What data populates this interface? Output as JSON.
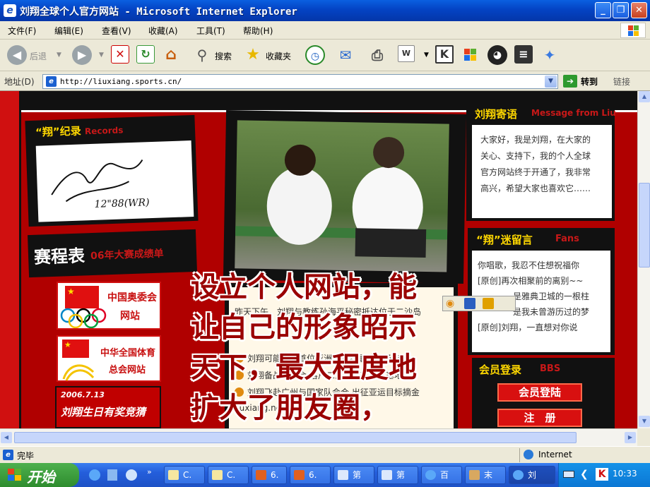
{
  "window": {
    "title": "刘翔全球个人官方网站 - Microsoft Internet Explorer",
    "app_icon": "ie-icon",
    "controls": [
      "minimize-icon",
      "maximize-icon",
      "close-icon"
    ]
  },
  "menubar": {
    "items": [
      "文件(F)",
      "编辑(E)",
      "查看(V)",
      "收藏(A)",
      "工具(T)",
      "帮助(H)"
    ]
  },
  "toolbar": {
    "back": "后退",
    "search": "搜索",
    "favorites": "收藏夹"
  },
  "addressbar": {
    "label": "地址(D)",
    "url": "http://liuxiang.sports.cn/",
    "go": "转到",
    "links": "链接"
  },
  "site": {
    "records": {
      "title": "“翔”纪录",
      "subtitle": "Records",
      "signature": "12\"88(WR)"
    },
    "schedule": {
      "title": "赛程表",
      "subtitle": "06年大赛成绩单"
    },
    "links": [
      {
        "line1": "中国奥委会",
        "line2": "网站"
      },
      {
        "line1": "中华全国体育",
        "line2": "总会网站"
      }
    ],
    "birthday_banner": {
      "date": "2006.7.13",
      "text": "刘翔生日有奖竞猜"
    },
    "message": {
      "title": "刘翔寄语",
      "subtitle": "Message from Liu",
      "lines": [
        "大家好，我是刘翔，在大家的",
        "关心、支持下，我的个人全球",
        "官方网站终于开通了，我非常",
        "高兴，希望大家也喜欢它……"
      ]
    },
    "fans": {
      "title": "“翔”迷留言",
      "subtitle": "Fans",
      "items": [
        "你唱歌，我忍不住想祝福你",
        "[原创]再次相聚前的离别~~",
        "是雅典卫城的一根柱",
        "是我未曾游历过的梦",
        "[原创]刘翔，一直想对你说"
      ]
    },
    "news": [
      "昨天下午，刘翔与教练孙海平秘密抵达位于二沙岛",
      "刘翔可能成为首位亚洲籍世界最佳田径选手",
      "刘翔备战亚运会 落户二沙岛体育训练基地",
      "刘翔飞赴广州与国家队会合 出征亚运目标摘金",
      "liuxiang.net"
    ],
    "members": {
      "title": "会员登录",
      "subtitle": "BBS",
      "login": "会员登陆",
      "register": "注　册"
    },
    "overlay_lines": [
      "设立个人网站，能",
      "让自己的形象昭示",
      "天下，最大程度地",
      "扩大了朋友圈，"
    ]
  },
  "statusbar": {
    "left": "完毕",
    "zone": "Internet"
  },
  "taskbar": {
    "start": "开始",
    "tasks": [
      "C.",
      "C.",
      "6.",
      "6.",
      "第",
      "第",
      "百",
      "末",
      "刘"
    ],
    "clock": "10:33"
  },
  "colors": {
    "title_blue": "#0443c4",
    "site_red": "#b00000",
    "overlay_text": "#9a0000"
  }
}
